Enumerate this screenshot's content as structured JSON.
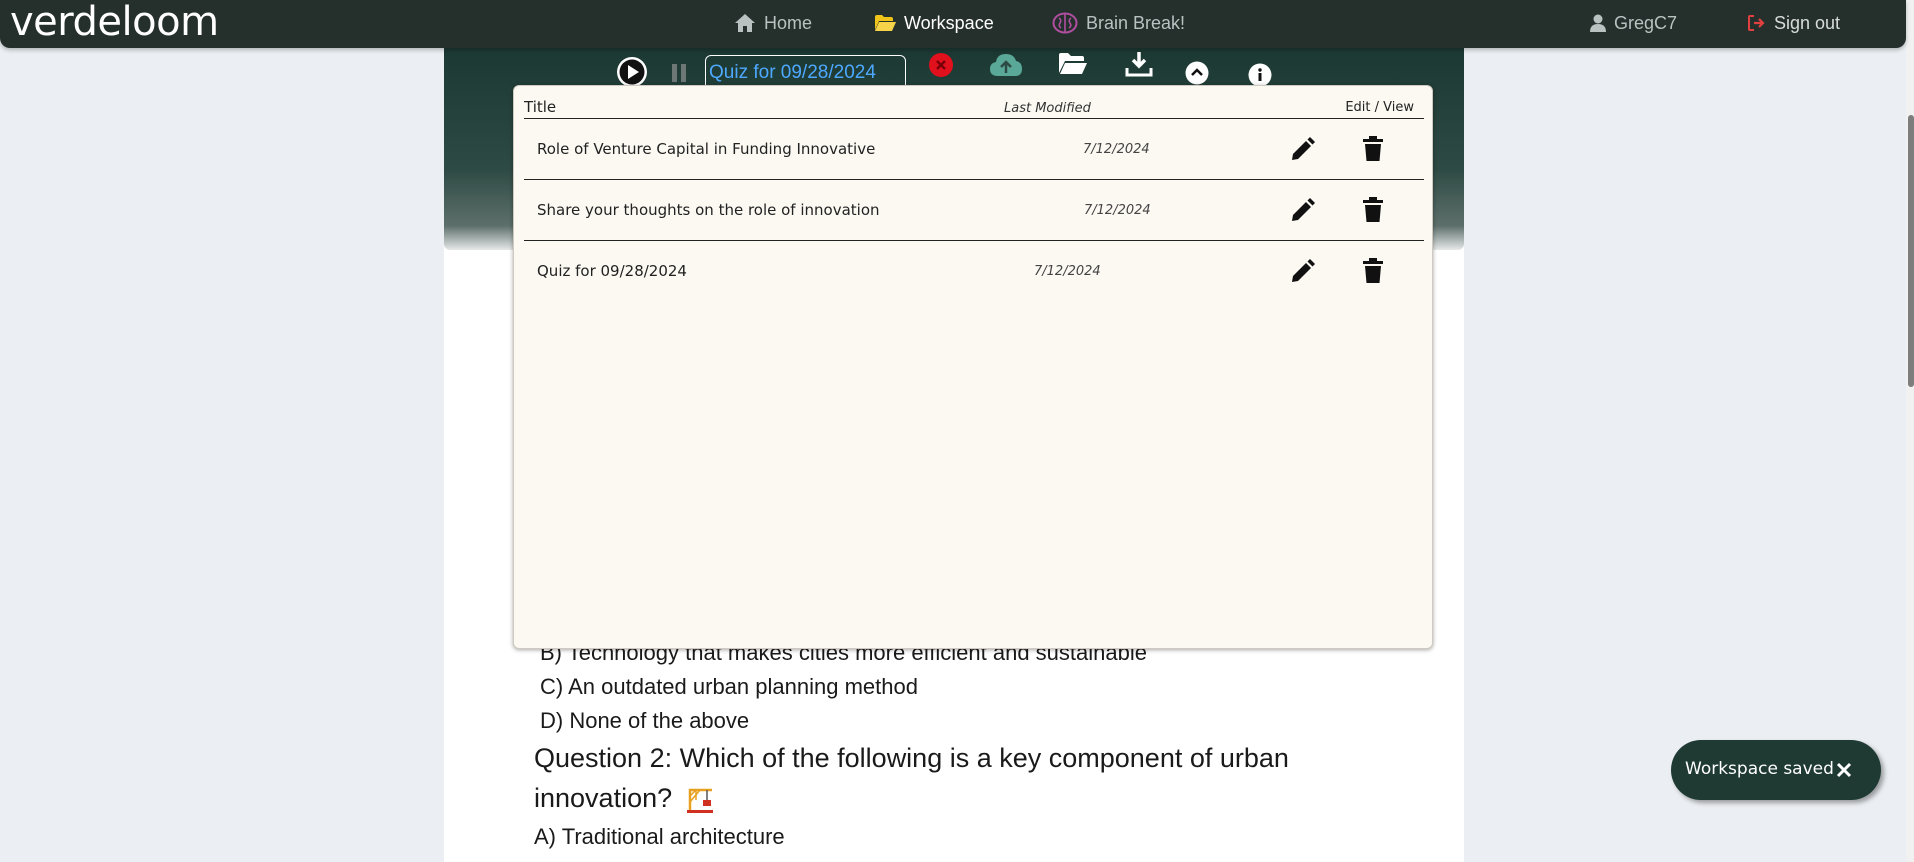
{
  "nav": {
    "brand": "verdeloom",
    "home": "Home",
    "workspace": "Workspace",
    "brain_break": "Brain Break!",
    "user": "GregC7",
    "sign_out": "Sign out"
  },
  "toolbar": {
    "title_value": "Quiz for 09/28/2024"
  },
  "file_list": {
    "headers": {
      "title": "Title",
      "last_modified": "Last Modified",
      "edit_view": "Edit / View"
    },
    "rows": [
      {
        "title": "Role of Venture Capital in Funding Innovative",
        "date": "7/12/2024"
      },
      {
        "title": "Share your thoughts on the role of innovation",
        "date": "7/12/2024"
      },
      {
        "title": "Quiz for 09/28/2024",
        "date": "7/12/2024"
      }
    ]
  },
  "quiz": {
    "option_b_partial": "B) Technology that makes cities more efficient and sustainable",
    "option_c": "C) An outdated urban planning method",
    "option_d": "D) None of the above",
    "question_2": "Question 2: Which of the following is a key component of urban innovation?",
    "q2_option_a": "A) Traditional architecture"
  },
  "toast": {
    "message": "Workspace saved"
  },
  "colors": {
    "navbar": "#25302d",
    "panel_header": "#1c3832",
    "file_list_bg": "#fcf9f3",
    "title_input_text": "#4da8ff",
    "toast_bg": "#1e3a33",
    "close_red": "#e0101c",
    "sign_out_icon": "#e04040",
    "brain_icon": "#b04fa0",
    "folder_icon": "#f0c419"
  }
}
